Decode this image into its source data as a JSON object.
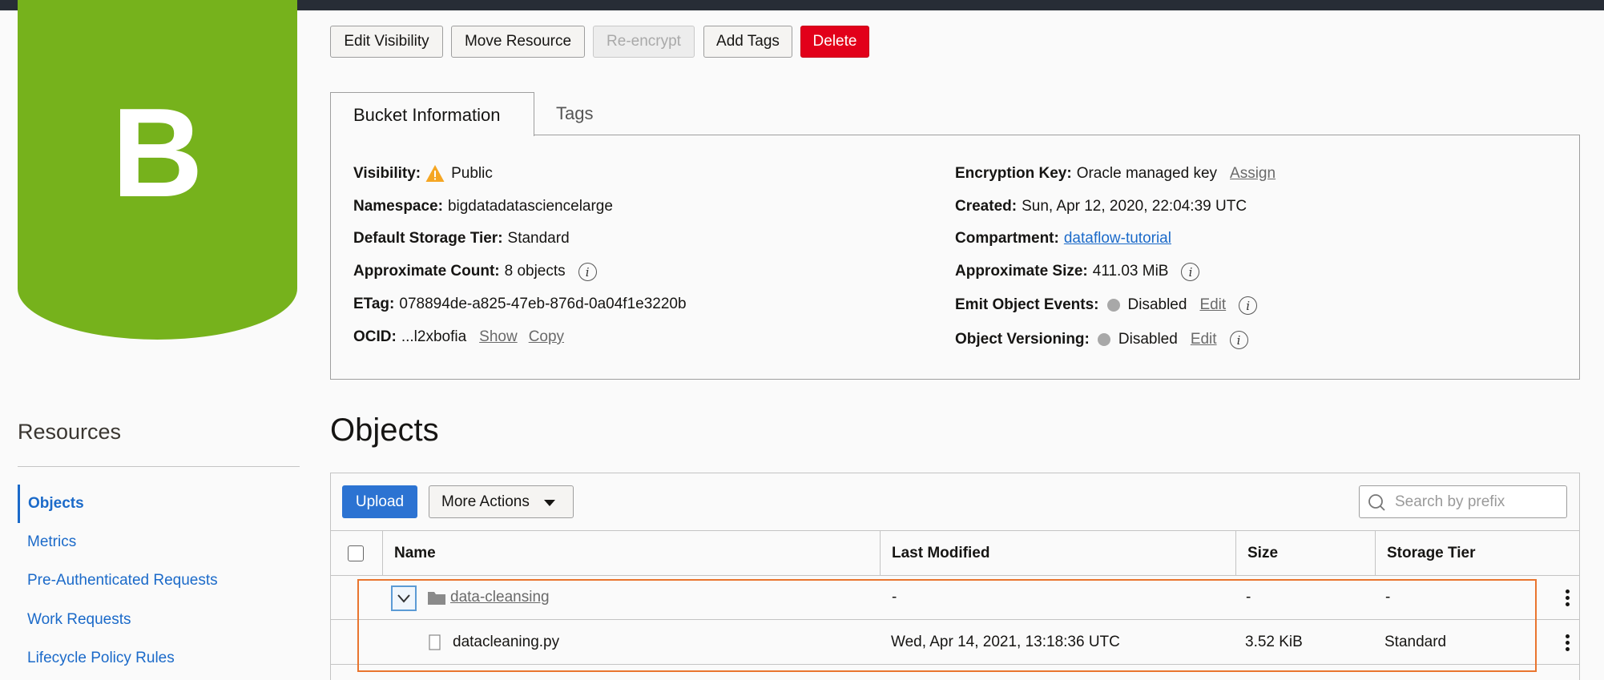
{
  "bucket": {
    "letter": "B",
    "color": "#76b21c"
  },
  "toolbar": {
    "edit_visibility": "Edit Visibility",
    "move_resource": "Move Resource",
    "re_encrypt": "Re-encrypt",
    "add_tags": "Add Tags",
    "delete": "Delete"
  },
  "tabs": {
    "bucket_info": "Bucket Information",
    "tags": "Tags"
  },
  "info": {
    "visibility_label": "Visibility:",
    "visibility_value": "Public",
    "namespace_label": "Namespace:",
    "namespace_value": "bigdatadatasciencelarge",
    "storage_tier_label": "Default Storage Tier:",
    "storage_tier_value": "Standard",
    "count_label": "Approximate Count:",
    "count_value": "8 objects",
    "etag_label": "ETag:",
    "etag_value": "078894de-a825-47eb-876d-0a04f1e3220b",
    "ocid_label": "OCID:",
    "ocid_value": "...l2xbofia",
    "ocid_show": "Show",
    "ocid_copy": "Copy",
    "encryption_label": "Encryption Key:",
    "encryption_value": "Oracle managed key",
    "encryption_assign": "Assign",
    "created_label": "Created:",
    "created_value": "Sun, Apr 12, 2020, 22:04:39 UTC",
    "compartment_label": "Compartment:",
    "compartment_value": "dataflow-tutorial",
    "size_label": "Approximate Size:",
    "size_value": "411.03 MiB",
    "events_label": "Emit Object Events:",
    "events_value": "Disabled",
    "events_edit": "Edit",
    "versioning_label": "Object Versioning:",
    "versioning_value": "Disabled",
    "versioning_edit": "Edit"
  },
  "resources": {
    "title": "Resources",
    "items": [
      "Objects",
      "Metrics",
      "Pre-Authenticated Requests",
      "Work Requests",
      "Lifecycle Policy Rules"
    ]
  },
  "objects": {
    "title": "Objects",
    "upload": "Upload",
    "more_actions": "More Actions",
    "search_placeholder": "Search by prefix",
    "columns": [
      "Name",
      "Last Modified",
      "Size",
      "Storage Tier"
    ],
    "rows": [
      {
        "name": "data-cleansing",
        "modified": "-",
        "size": "-",
        "tier": "-"
      },
      {
        "name": "datacleaning.py",
        "modified": "Wed, Apr 14, 2021, 13:18:36 UTC",
        "size": "3.52 KiB",
        "tier": "Standard"
      }
    ]
  },
  "colors": {
    "accent": "#2c73d2",
    "danger": "#e2001a",
    "highlight": "#e9752f"
  }
}
